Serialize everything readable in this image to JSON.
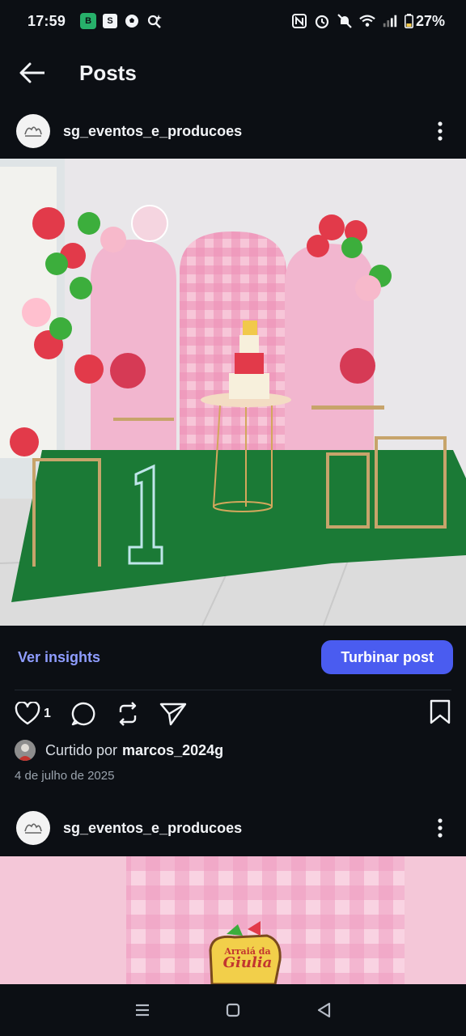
{
  "status_bar": {
    "time": "17:59",
    "battery": "27%",
    "left_icons": [
      "whatsapp-business-icon",
      "shopping-bag-icon",
      "soccer-ball-icon",
      "search-sparkle-icon"
    ],
    "right_icons": [
      "nfc-icon",
      "alarm-icon",
      "mute-icon",
      "wifi-icon",
      "signal-icon"
    ]
  },
  "header": {
    "title": "Posts"
  },
  "posts": [
    {
      "username": "sg_eventos_e_producoes",
      "insights_label": "Ver insights",
      "boost_label": "Turbinar post",
      "like_count": "1",
      "liked_by_prefix": "Curtido por",
      "liked_by_user": "marcos_2024g",
      "date": "4 de julho de 2025"
    },
    {
      "username": "sg_eventos_e_producoes",
      "sign_line1": "Arraiá da",
      "sign_line2": "Giulia"
    }
  ],
  "colors": {
    "background": "#0c0f14",
    "accent": "#4a5cf0",
    "link": "#8f9dff"
  }
}
